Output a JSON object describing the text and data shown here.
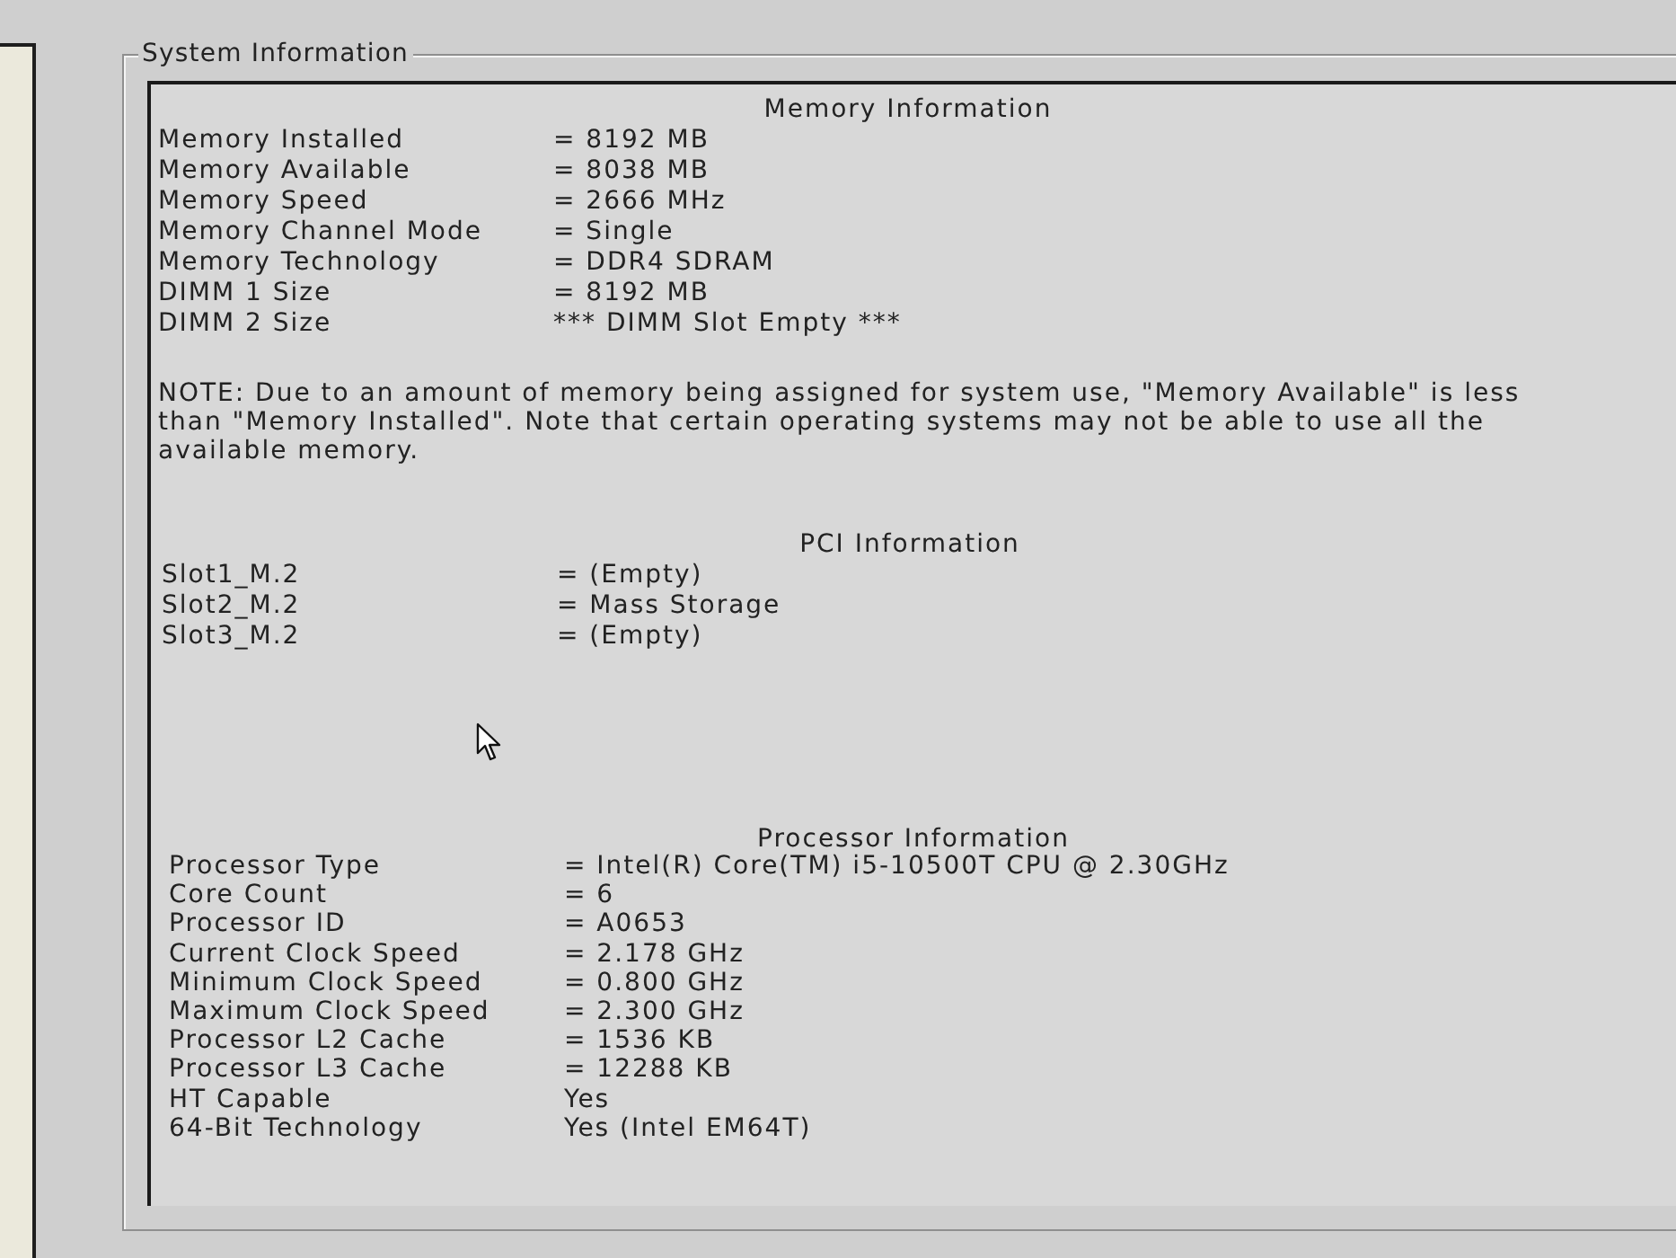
{
  "window": {
    "title": "System Information"
  },
  "sections": [
    {
      "heading": "Memory Information",
      "rows": [
        {
          "label": "Memory Installed",
          "value": "= 8192 MB"
        },
        {
          "label": "Memory Available",
          "value": "= 8038 MB"
        },
        {
          "label": "Memory Speed",
          "value": "= 2666 MHz"
        },
        {
          "label": "Memory Channel Mode",
          "value": "= Single"
        },
        {
          "label": "Memory Technology",
          "value": "= DDR4 SDRAM"
        },
        {
          "label": "DIMM 1 Size",
          "value": "= 8192 MB"
        },
        {
          "label": "DIMM 2 Size",
          "value": "*** DIMM Slot Empty ***"
        }
      ],
      "note": "NOTE: Due to an amount of memory being assigned for system use, \"Memory Available\" is less than \"Memory Installed\". Note that certain operating systems may not be able to use all the available memory."
    },
    {
      "heading": "PCI Information",
      "rows": [
        {
          "label": "Slot1_M.2",
          "value": "= (Empty)"
        },
        {
          "label": "Slot2_M.2",
          "value": "= Mass Storage"
        },
        {
          "label": "Slot3_M.2",
          "value": "= (Empty)"
        }
      ]
    },
    {
      "heading": "Processor Information",
      "rows": [
        {
          "label": "Processor Type",
          "value": "= Intel(R) Core(TM) i5-10500T CPU @ 2.30GHz"
        },
        {
          "label": "Core Count",
          "value": "= 6"
        },
        {
          "label": "Processor ID",
          "value": "= A0653"
        },
        {
          "label": "Current Clock Speed",
          "value": "= 2.178 GHz"
        },
        {
          "label": "Minimum Clock Speed",
          "value": "= 0.800 GHz"
        },
        {
          "label": "Maximum Clock Speed",
          "value": "= 2.300 GHz"
        },
        {
          "label": "Processor L2 Cache",
          "value": "= 1536 KB"
        },
        {
          "label": "Processor L3 Cache",
          "value": "= 12288 KB"
        },
        {
          "label": "HT Capable",
          "value": "Yes"
        },
        {
          "label": "64-Bit Technology",
          "value": "Yes (Intel EM64T)"
        }
      ]
    }
  ]
}
